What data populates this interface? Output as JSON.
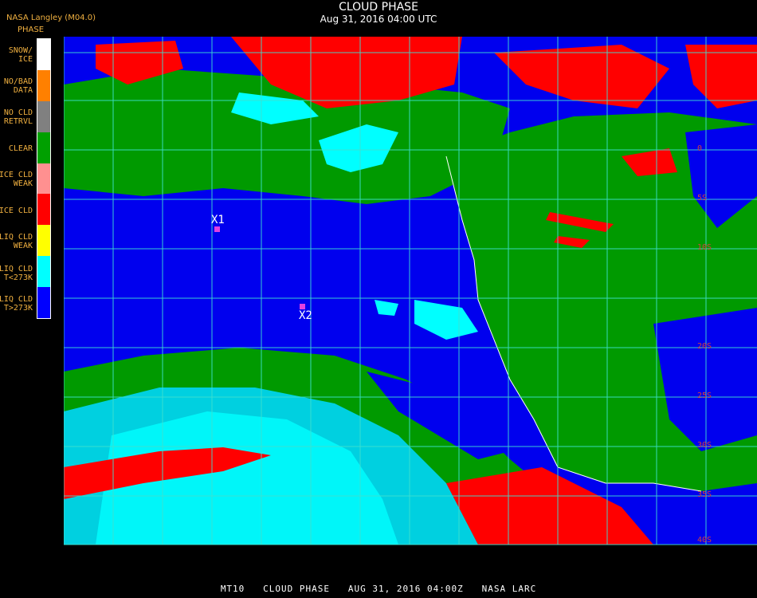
{
  "header": {
    "title": "CLOUD PHASE",
    "subtitle": "Aug 31, 2016 04:00 UTC",
    "provider": "NASA Langley (M04.0)"
  },
  "legend": {
    "title": "PHASE",
    "items": [
      {
        "label": "SNOW/\nICE",
        "color": "#ffffff"
      },
      {
        "label": "NO/BAD\nDATA",
        "color": "#ff8000"
      },
      {
        "label": "NO CLD\nRETRVL",
        "color": "#808080"
      },
      {
        "label": "CLEAR",
        "color": "#00a000"
      },
      {
        "label": "ICE CLD\nWEAK",
        "color": "#ff9090"
      },
      {
        "label": "ICE CLD",
        "color": "#ff0000"
      },
      {
        "label": "LIQ CLD\nWEAK",
        "color": "#ffff00"
      },
      {
        "label": "LIQ CLD\nT<273K",
        "color": "#00ffff"
      },
      {
        "label": "LIQ CLD\nT>273K",
        "color": "#0000ff"
      }
    ]
  },
  "markers": [
    {
      "label": "X1"
    },
    {
      "label": "X2"
    }
  ],
  "lat_labels": [
    "0",
    "5S",
    "10S",
    "20S",
    "25S",
    "30S",
    "35S",
    "40S"
  ],
  "footer": "MT10   CLOUD PHASE   AUG 31, 2016 04:00Z   NASA LARC"
}
